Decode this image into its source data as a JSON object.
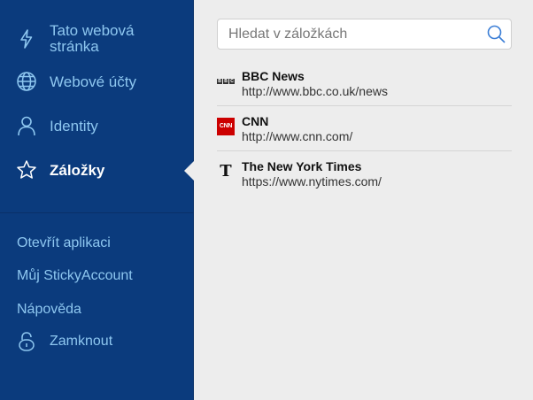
{
  "sidebar": {
    "nav": [
      {
        "id": "this-page",
        "label_line1": "Tato webová",
        "label_line2": "stránka",
        "icon": "lightning-icon"
      },
      {
        "id": "web-accounts",
        "label": "Webové účty",
        "icon": "globe-icon"
      },
      {
        "id": "identities",
        "label": "Identity",
        "icon": "person-icon"
      },
      {
        "id": "bookmarks",
        "label": "Záložky",
        "icon": "star-icon",
        "active": true
      }
    ],
    "links": [
      {
        "id": "open-app",
        "label": "Otevřít aplikaci"
      },
      {
        "id": "my-account",
        "label": "Můj StickyAccount"
      },
      {
        "id": "help",
        "label": "Nápověda"
      }
    ],
    "lock": {
      "label": "Zamknout",
      "icon": "lock-icon"
    }
  },
  "search": {
    "placeholder": "Hledat v záložkách",
    "value": ""
  },
  "bookmarks": [
    {
      "title": "BBC News",
      "url": "http://www.bbc.co.uk/news",
      "favicon": "bbc-favicon",
      "favicon_text": "BBC"
    },
    {
      "title": "CNN",
      "url": "http://www.cnn.com/",
      "favicon": "cnn-favicon",
      "favicon_text": "CNN"
    },
    {
      "title": "The New York Times",
      "url": "https://www.nytimes.com/",
      "favicon": "nyt-favicon",
      "favicon_text": "T"
    }
  ],
  "colors": {
    "sidebar_bg": "#0b3b7d",
    "sidebar_text": "#8ec7f0",
    "active_text": "#ffffff",
    "main_bg": "#ededed",
    "cnn_red": "#cc0000"
  }
}
